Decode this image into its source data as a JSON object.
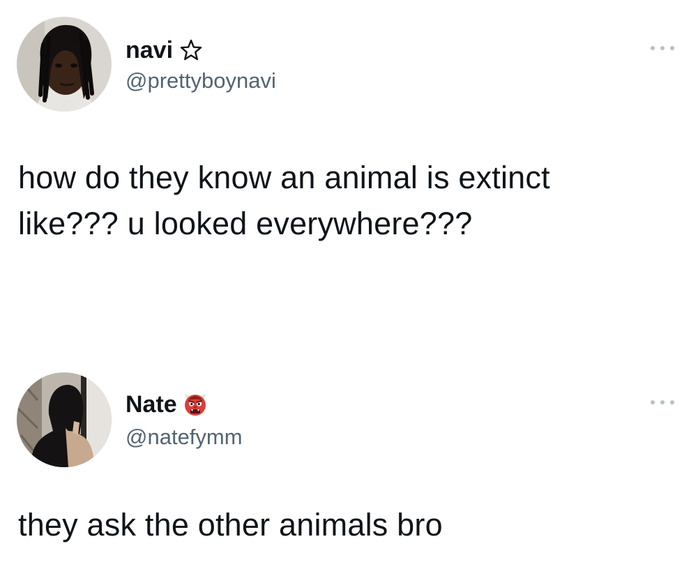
{
  "tweets": [
    {
      "author": {
        "display_name": "navi",
        "name_emoji": "star-outline-icon",
        "handle": "@prettyboynavi",
        "avatar": "avatar-photo"
      },
      "more_icon": "more-options-icon",
      "text_lines": [
        "how do they know an animal is extinct",
        "like??? u looked everywhere???"
      ]
    },
    {
      "author": {
        "display_name": "Nate",
        "name_emoji": "red-ogre-icon",
        "handle": "@natefymm",
        "avatar": "avatar-photo"
      },
      "more_icon": "more-options-icon",
      "text_lines": [
        "they ask the other animals bro"
      ]
    }
  ],
  "colors": {
    "text_primary": "#0f1419",
    "text_secondary": "#536471",
    "background": "#ffffff",
    "emoji_red": "#d8403a"
  }
}
